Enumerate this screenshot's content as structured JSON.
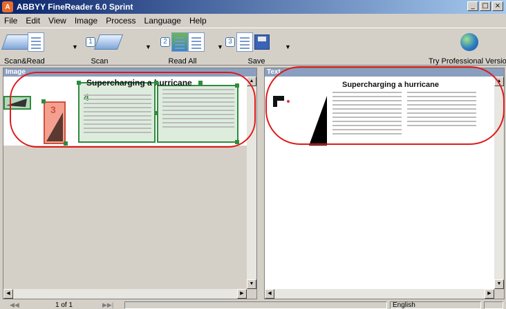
{
  "window": {
    "title": "ABBYY FineReader 6.0 Sprint",
    "minimize": "_",
    "maximize": "□",
    "close": "×"
  },
  "menu": [
    "File",
    "Edit",
    "View",
    "Image",
    "Process",
    "Language",
    "Help"
  ],
  "toolbar": {
    "scan_read": "Scan&Read",
    "scan": "Scan",
    "read_all": "Read All",
    "save": "Save",
    "try_pro": "Try Professional Version",
    "step1": "1",
    "step2": "2",
    "step3": "3"
  },
  "image_panel": {
    "header": "Image",
    "block_number_picture": "3",
    "block_number_text": "4",
    "document_title": "Supercharging a hurricane"
  },
  "text_panel": {
    "header": "Text",
    "document_title": "Supercharging a hurricane"
  },
  "statusbar": {
    "page": "1 of 1",
    "language": "English"
  },
  "colors": {
    "annotation_red": "#e01818",
    "block_green": "#2e8b3e",
    "picture_block": "#f4a090"
  }
}
